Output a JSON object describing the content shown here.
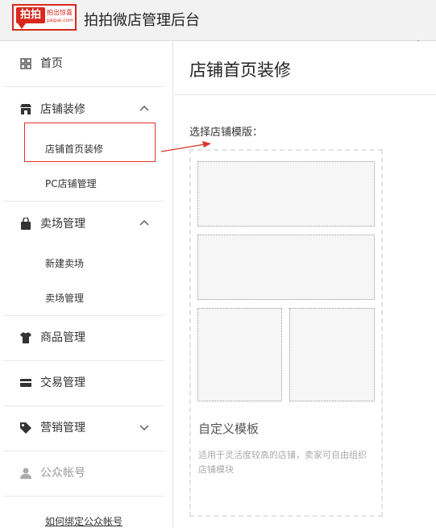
{
  "header": {
    "logo_main": "拍拍",
    "logo_sub_line1": "拍出惊喜",
    "logo_sub_line2": "paipai.com",
    "app_title": "拍拍微店管理后台"
  },
  "sidebar": {
    "items": [
      {
        "label": "首页",
        "icon": "grid-icon"
      },
      {
        "label": "店铺装修",
        "icon": "store-icon",
        "expanded": true,
        "children": [
          {
            "label": "店铺首页装修",
            "active": true
          },
          {
            "label": "PC店铺管理"
          }
        ]
      },
      {
        "label": "卖场管理",
        "icon": "bag-icon",
        "expanded": true,
        "children": [
          {
            "label": "新建卖场"
          },
          {
            "label": "卖场管理"
          }
        ]
      },
      {
        "label": "商品管理",
        "icon": "tshirt-icon"
      },
      {
        "label": "交易管理",
        "icon": "card-icon"
      },
      {
        "label": "营销管理",
        "icon": "tag-icon",
        "expanded": false
      },
      {
        "label": "公众帐号",
        "icon": "user-icon",
        "disabled": true
      }
    ],
    "bottom_link": "如何绑定公众帐号"
  },
  "main": {
    "page_title": "店铺首页装修",
    "select_label": "选择店铺模版：",
    "template": {
      "name": "自定义模板",
      "description": "适用于灵活度较高的店铺，卖家可自由组织店铺模块"
    }
  },
  "colors": {
    "brand": "#d9281e",
    "highlight_border": "#e0322b",
    "annotation_arrow": "#e0322b"
  }
}
